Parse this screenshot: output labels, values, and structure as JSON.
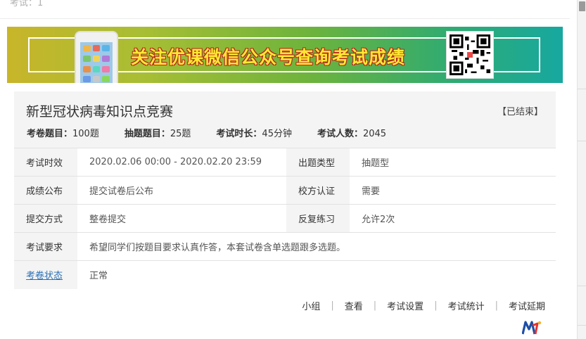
{
  "top_strip": {
    "text": "考试：1"
  },
  "banner": {
    "title": "关注优课微信公众号查询考试成绩"
  },
  "exam": {
    "title": "新型冠状病毒知识点竞赛",
    "status": "【已结束】",
    "stats": [
      {
        "label": "考卷题目：",
        "value": "100题"
      },
      {
        "label": "抽题题目：",
        "value": "25题"
      },
      {
        "label": "考试时长：",
        "value": "45分钟"
      },
      {
        "label": "考试人数：",
        "value": "2045"
      }
    ],
    "rows": {
      "validity_label": "考试时效",
      "validity_value": "2020.02.06 00:00 - 2020.02.20 23:59",
      "type_label": "出题类型",
      "type_value": "抽题型",
      "publish_label": "成绩公布",
      "publish_value": "提交试卷后公布",
      "auth_label": "校方认证",
      "auth_value": "需要",
      "submit_label": "提交方式",
      "submit_value": "整卷提交",
      "practice_label": "反复练习",
      "practice_value": "允许2次",
      "require_label": "考试要求",
      "require_value": "希望同学们按题目要求认真作答，本套试卷含单选题跟多选题。",
      "state_label": "考卷状态",
      "state_value": "正常"
    }
  },
  "actions": [
    "小组",
    "查看",
    "考试设置",
    "考试统计",
    "考试延期"
  ],
  "colors": {
    "link": "#2a6fb5",
    "card_bg": "#f4f4f4",
    "banner_text": "#ffe833"
  },
  "icons": {
    "logo": "brand-logo-icon",
    "qr": "qr-code-icon",
    "phone": "phone-icon"
  }
}
